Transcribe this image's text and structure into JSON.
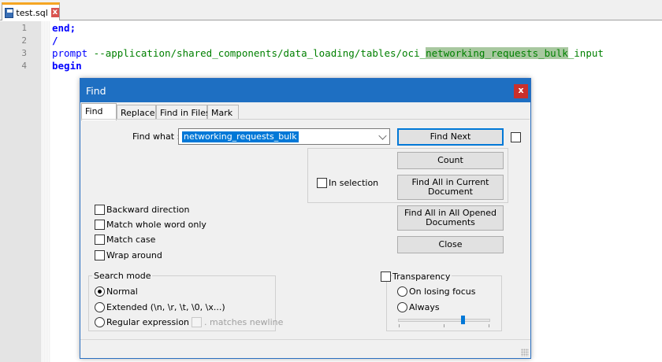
{
  "tabbar": {
    "file_tab": "test.sql",
    "close_glyph": "x"
  },
  "editor": {
    "line_numbers": [
      "1",
      "2",
      "3",
      "4"
    ],
    "lines": {
      "l1": "end;",
      "l2": "/",
      "l3_prompt": "prompt",
      "l3_comment": " --application/shared_components/data_loading/tables/oci_",
      "l3_highlight": "networking_requests_bulk",
      "l3_tail": "_input",
      "l4": "begin"
    },
    "highlight_color": "#a8c8a0"
  },
  "dialog": {
    "title": "Find",
    "close_glyph": "x",
    "tabs": [
      "Find",
      "Replace",
      "Find in Files",
      "Mark"
    ],
    "active_tab": "Find",
    "find_what_label": "Find what :",
    "find_what_value": "networking_requests_bulk",
    "buttons": {
      "find_next": "Find Next",
      "count": "Count",
      "find_all_current": "Find All in Current Document",
      "find_all_opened": "Find All in All Opened Documents",
      "close": "Close"
    },
    "in_selection": "In selection",
    "options": {
      "backward": "Backward direction",
      "whole_word": "Match whole word only",
      "match_case": "Match case",
      "wrap_around": "Wrap around"
    },
    "search_mode": {
      "title": "Search mode",
      "normal": "Normal",
      "extended": "Extended (\\n, \\r, \\t, \\0, \\x...)",
      "regex": "Regular expression",
      "matches_newline": ". matches newline",
      "selected": "Normal"
    },
    "transparency": {
      "title": "Transparency",
      "on_losing_focus": "On losing focus",
      "always": "Always",
      "level": 0.72
    },
    "accent_color": "#1e6fc2"
  }
}
